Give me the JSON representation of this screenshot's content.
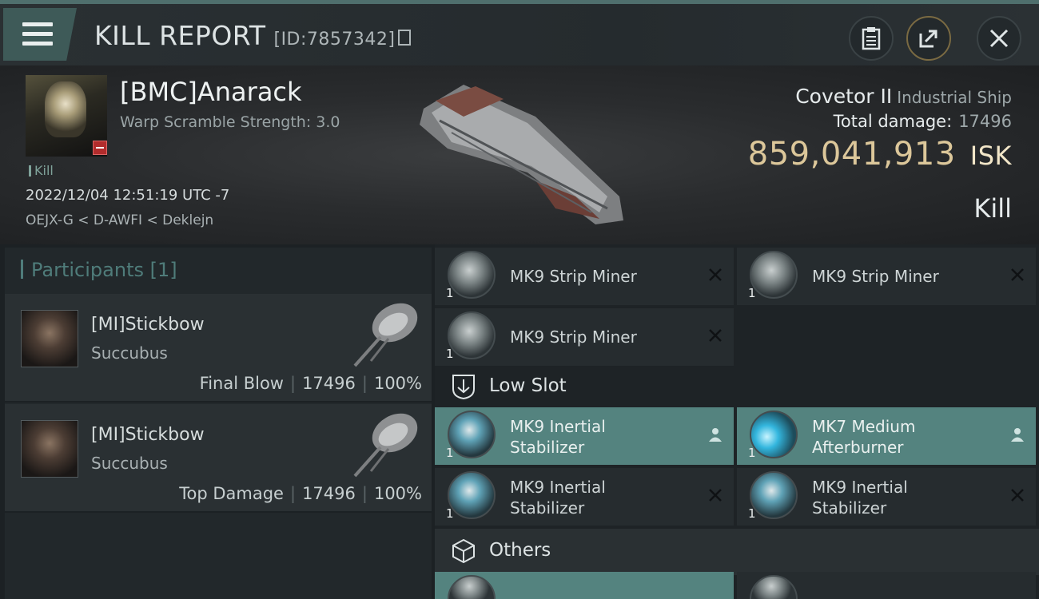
{
  "header": {
    "title": "KILL REPORT",
    "report_id": "[ID:7857342]"
  },
  "victim": {
    "name": "[BMC]Anarack",
    "warp_scramble": "Warp Scramble Strength: 3.0",
    "kill_tag": "Kill",
    "timestamp": "2022/12/04 12:51:19 UTC -7",
    "location": "OEJX-G < D-AWFI < Deklejn"
  },
  "ship": {
    "name": "Covetor II",
    "class": "Industrial Ship",
    "damage_label": "Total damage:",
    "damage_value": "17496",
    "value": "859,041,913",
    "currency": "ISK",
    "status": "Kill"
  },
  "participants": {
    "title": "Participants [1]",
    "rows": [
      {
        "name": "[MI]Stickbow",
        "ship": "Succubus",
        "role": "Final Blow",
        "damage": "17496",
        "percent": "100%"
      },
      {
        "name": "[MI]Stickbow",
        "ship": "Succubus",
        "role": "Top Damage",
        "damage": "17496",
        "percent": "100%"
      }
    ]
  },
  "fitting": {
    "top_items": [
      {
        "qty": "1",
        "name": "MK9 Strip Miner"
      },
      {
        "qty": "1",
        "name": "MK9 Strip Miner"
      },
      {
        "qty": "1",
        "name": "MK9 Strip Miner"
      }
    ],
    "low_slot_label": "Low Slot",
    "low_items": [
      {
        "qty": "1",
        "line1": "MK9 Inertial",
        "line2": "Stabilizer"
      },
      {
        "qty": "1",
        "line1": "MK7 Medium",
        "line2": "Afterburner"
      },
      {
        "qty": "1",
        "line1": "MK9 Inertial",
        "line2": "Stabilizer"
      },
      {
        "qty": "1",
        "line1": "MK9 Inertial",
        "line2": "Stabilizer"
      }
    ],
    "others_label": "Others"
  },
  "colors": {
    "accent": "#54837f",
    "isk": "#dcc79a",
    "danger": "#b12c2c"
  }
}
